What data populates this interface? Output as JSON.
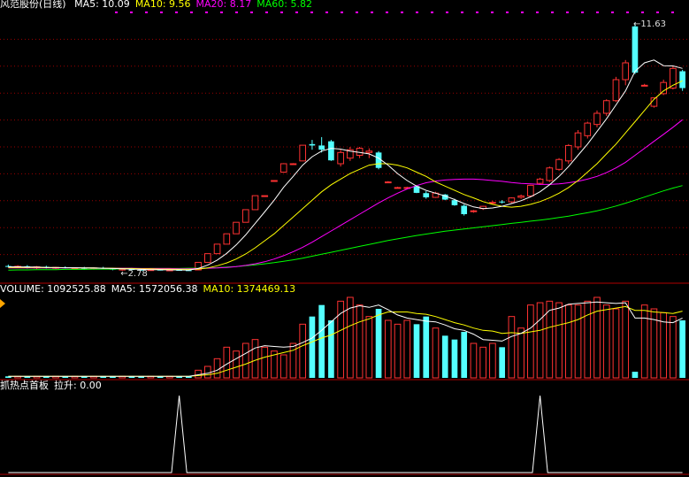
{
  "main_panel": {
    "title": "风范股份(日线)",
    "indicators": [
      {
        "label": "MA5: 10.09",
        "color": "#ffffff"
      },
      {
        "label": "MA10: 9.56",
        "color": "#ffff00"
      },
      {
        "label": "MA20: 8.17",
        "color": "#ff00ff"
      },
      {
        "label": "MA60: 5.82",
        "color": "#00ff00"
      }
    ],
    "high_label": "11.63",
    "low_label": "2.78"
  },
  "volume_panel": {
    "indicators": [
      {
        "label": "VOLUME: 1092525.88",
        "color": "#ffffff"
      },
      {
        "label": "MA5: 1572056.38",
        "color": "#ffffff"
      },
      {
        "label": "MA10: 1374469.13",
        "color": "#ffff00"
      }
    ]
  },
  "indicator_panel": {
    "indicators": [
      {
        "label": "抓热点首板",
        "color": "#ffffff"
      },
      {
        "label": "拉升: 0.00",
        "color": "#ffffff"
      }
    ]
  },
  "colors": {
    "up": "#ff3232",
    "down": "#54ffff",
    "ma5": "#ffffff",
    "ma10": "#ffff00",
    "ma20": "#ff00ff",
    "ma60": "#00ff00",
    "grid": "#9a0000",
    "dots": "#ff00ff"
  },
  "chart_data": {
    "type": "candlestick",
    "ylim": [
      2.4,
      12.0
    ],
    "candles": [
      {
        "o": 2.95,
        "h": 3.0,
        "l": 2.9,
        "c": 2.92
      },
      {
        "o": 2.92,
        "h": 2.98,
        "l": 2.88,
        "c": 2.94
      },
      {
        "o": 2.94,
        "h": 2.98,
        "l": 2.86,
        "c": 2.88
      },
      {
        "o": 2.88,
        "h": 2.95,
        "l": 2.84,
        "c": 2.92
      },
      {
        "o": 2.92,
        "h": 2.96,
        "l": 2.86,
        "c": 2.88
      },
      {
        "o": 2.88,
        "h": 2.92,
        "l": 2.84,
        "c": 2.9
      },
      {
        "o": 2.9,
        "h": 2.94,
        "l": 2.86,
        "c": 2.87
      },
      {
        "o": 2.87,
        "h": 2.9,
        "l": 2.83,
        "c": 2.88
      },
      {
        "o": 2.88,
        "h": 2.92,
        "l": 2.82,
        "c": 2.85
      },
      {
        "o": 2.85,
        "h": 2.9,
        "l": 2.82,
        "c": 2.88
      },
      {
        "o": 2.88,
        "h": 2.92,
        "l": 2.84,
        "c": 2.86
      },
      {
        "o": 2.86,
        "h": 2.88,
        "l": 2.8,
        "c": 2.82
      },
      {
        "o": 2.82,
        "h": 2.86,
        "l": 2.78,
        "c": 2.84
      },
      {
        "o": 2.84,
        "h": 2.88,
        "l": 2.8,
        "c": 2.82
      },
      {
        "o": 2.82,
        "h": 2.86,
        "l": 2.78,
        "c": 2.8
      },
      {
        "o": 2.8,
        "h": 2.84,
        "l": 2.78,
        "c": 2.82
      },
      {
        "o": 2.82,
        "h": 2.85,
        "l": 2.79,
        "c": 2.8
      },
      {
        "o": 2.8,
        "h": 2.83,
        "l": 2.78,
        "c": 2.81
      },
      {
        "o": 2.81,
        "h": 2.84,
        "l": 2.78,
        "c": 2.8
      },
      {
        "o": 2.8,
        "h": 2.82,
        "l": 2.78,
        "c": 2.79
      },
      {
        "o": 2.81,
        "h": 3.08,
        "l": 2.8,
        "c": 3.08
      },
      {
        "o": 3.08,
        "h": 3.39,
        "l": 3.08,
        "c": 3.39
      },
      {
        "o": 3.39,
        "h": 3.73,
        "l": 3.39,
        "c": 3.73
      },
      {
        "o": 3.73,
        "h": 4.1,
        "l": 3.73,
        "c": 4.1
      },
      {
        "o": 4.1,
        "h": 4.51,
        "l": 4.1,
        "c": 4.51
      },
      {
        "o": 4.51,
        "h": 4.96,
        "l": 4.51,
        "c": 4.96
      },
      {
        "o": 4.96,
        "h": 5.46,
        "l": 4.96,
        "c": 5.46
      },
      {
        "o": 5.46,
        "h": 5.46,
        "l": 5.46,
        "c": 5.46
      },
      {
        "o": 6.0,
        "h": 6.0,
        "l": 6.0,
        "c": 6.0
      },
      {
        "o": 6.3,
        "h": 6.62,
        "l": 6.28,
        "c": 6.6
      },
      {
        "o": 6.6,
        "h": 6.62,
        "l": 6.58,
        "c": 6.6
      },
      {
        "o": 6.7,
        "h": 7.26,
        "l": 6.7,
        "c": 7.26
      },
      {
        "o": 7.3,
        "h": 7.45,
        "l": 7.1,
        "c": 7.25
      },
      {
        "o": 7.25,
        "h": 7.55,
        "l": 7.0,
        "c": 7.1
      },
      {
        "o": 7.4,
        "h": 7.45,
        "l": 6.7,
        "c": 6.72
      },
      {
        "o": 6.6,
        "h": 7.1,
        "l": 6.5,
        "c": 7.0
      },
      {
        "o": 6.8,
        "h": 7.2,
        "l": 6.7,
        "c": 7.1
      },
      {
        "o": 6.9,
        "h": 7.2,
        "l": 6.8,
        "c": 7.15
      },
      {
        "o": 7.0,
        "h": 7.15,
        "l": 6.8,
        "c": 7.05
      },
      {
        "o": 7.0,
        "h": 7.05,
        "l": 6.4,
        "c": 6.45
      },
      {
        "o": 5.95,
        "h": 5.98,
        "l": 5.92,
        "c": 5.95
      },
      {
        "o": 5.75,
        "h": 5.78,
        "l": 5.72,
        "c": 5.75
      },
      {
        "o": 5.75,
        "h": 5.78,
        "l": 5.72,
        "c": 5.75
      },
      {
        "o": 5.8,
        "h": 5.82,
        "l": 5.55,
        "c": 5.56
      },
      {
        "o": 5.55,
        "h": 5.62,
        "l": 5.35,
        "c": 5.4
      },
      {
        "o": 5.4,
        "h": 5.6,
        "l": 5.38,
        "c": 5.55
      },
      {
        "o": 5.5,
        "h": 5.52,
        "l": 5.3,
        "c": 5.32
      },
      {
        "o": 5.3,
        "h": 5.35,
        "l": 5.1,
        "c": 5.12
      },
      {
        "o": 5.1,
        "h": 5.15,
        "l": 4.75,
        "c": 4.8
      },
      {
        "o": 4.9,
        "h": 4.95,
        "l": 4.85,
        "c": 4.92
      },
      {
        "o": 5.0,
        "h": 5.1,
        "l": 4.95,
        "c": 5.08
      },
      {
        "o": 5.2,
        "h": 5.28,
        "l": 5.15,
        "c": 5.22
      },
      {
        "o": 5.25,
        "h": 5.3,
        "l": 5.18,
        "c": 5.24
      },
      {
        "o": 5.24,
        "h": 5.4,
        "l": 5.2,
        "c": 5.38
      },
      {
        "o": 5.4,
        "h": 5.5,
        "l": 5.35,
        "c": 5.45
      },
      {
        "o": 5.45,
        "h": 5.85,
        "l": 5.4,
        "c": 5.83
      },
      {
        "o": 5.9,
        "h": 6.1,
        "l": 5.85,
        "c": 6.05
      },
      {
        "o": 6.0,
        "h": 6.5,
        "l": 5.95,
        "c": 6.45
      },
      {
        "o": 6.4,
        "h": 6.8,
        "l": 6.35,
        "c": 6.75
      },
      {
        "o": 6.7,
        "h": 7.3,
        "l": 6.6,
        "c": 7.25
      },
      {
        "o": 7.2,
        "h": 7.8,
        "l": 7.1,
        "c": 7.7
      },
      {
        "o": 7.6,
        "h": 8.1,
        "l": 7.5,
        "c": 8.05
      },
      {
        "o": 8.0,
        "h": 8.5,
        "l": 7.9,
        "c": 8.4
      },
      {
        "o": 8.4,
        "h": 8.9,
        "l": 8.3,
        "c": 8.85
      },
      {
        "o": 8.85,
        "h": 9.7,
        "l": 8.8,
        "c": 9.6
      },
      {
        "o": 9.6,
        "h": 10.3,
        "l": 9.4,
        "c": 10.2
      },
      {
        "o": 11.5,
        "h": 11.63,
        "l": 9.8,
        "c": 9.85
      },
      {
        "o": 9.4,
        "h": 9.45,
        "l": 9.38,
        "c": 9.4
      },
      {
        "o": 8.65,
        "h": 8.95,
        "l": 8.6,
        "c": 8.95
      },
      {
        "o": 9.1,
        "h": 9.6,
        "l": 9.05,
        "c": 9.5
      },
      {
        "o": 9.3,
        "h": 10.1,
        "l": 9.25,
        "c": 10.0
      },
      {
        "o": 9.9,
        "h": 9.95,
        "l": 9.2,
        "c": 9.3
      }
    ],
    "ma5": [
      2.92,
      2.92,
      2.91,
      2.91,
      2.9,
      2.9,
      2.89,
      2.89,
      2.88,
      2.88,
      2.87,
      2.86,
      2.85,
      2.84,
      2.83,
      2.82,
      2.82,
      2.81,
      2.81,
      2.8,
      2.86,
      2.98,
      3.16,
      3.4,
      3.7,
      4.06,
      4.47,
      4.88,
      5.3,
      5.76,
      6.15,
      6.55,
      6.85,
      7.05,
      7.15,
      7.12,
      7.05,
      7.0,
      6.95,
      6.8,
      6.55,
      6.25,
      6.0,
      5.8,
      5.65,
      5.55,
      5.45,
      5.32,
      5.18,
      5.06,
      5.0,
      5.02,
      5.08,
      5.18,
      5.28,
      5.42,
      5.6,
      5.85,
      6.15,
      6.5,
      6.9,
      7.3,
      7.75,
      8.2,
      8.7,
      9.2,
      9.9,
      10.2,
      10.3,
      10.1,
      10.09,
      10.0
    ],
    "ma10": [
      2.9,
      2.9,
      2.9,
      2.9,
      2.89,
      2.89,
      2.89,
      2.88,
      2.88,
      2.88,
      2.87,
      2.87,
      2.86,
      2.86,
      2.85,
      2.85,
      2.84,
      2.84,
      2.83,
      2.83,
      2.84,
      2.88,
      2.96,
      3.06,
      3.2,
      3.38,
      3.6,
      3.85,
      4.1,
      4.4,
      4.7,
      5.0,
      5.3,
      5.6,
      5.85,
      6.05,
      6.25,
      6.4,
      6.55,
      6.6,
      6.6,
      6.55,
      6.45,
      6.3,
      6.15,
      5.95,
      5.8,
      5.65,
      5.5,
      5.38,
      5.25,
      5.15,
      5.08,
      5.05,
      5.08,
      5.15,
      5.25,
      5.38,
      5.55,
      5.75,
      6.0,
      6.3,
      6.6,
      6.95,
      7.3,
      7.7,
      8.1,
      8.5,
      8.9,
      9.2,
      9.4,
      9.56
    ],
    "ma20": [
      2.88,
      2.88,
      2.88,
      2.88,
      2.88,
      2.88,
      2.88,
      2.88,
      2.88,
      2.87,
      2.87,
      2.87,
      2.87,
      2.87,
      2.86,
      2.86,
      2.86,
      2.86,
      2.85,
      2.85,
      2.86,
      2.87,
      2.88,
      2.9,
      2.93,
      2.97,
      3.03,
      3.1,
      3.2,
      3.32,
      3.46,
      3.62,
      3.8,
      4.0,
      4.2,
      4.4,
      4.6,
      4.8,
      5.0,
      5.2,
      5.38,
      5.55,
      5.7,
      5.82,
      5.92,
      5.98,
      6.02,
      6.04,
      6.05,
      6.05,
      6.03,
      6.0,
      5.97,
      5.93,
      5.9,
      5.88,
      5.86,
      5.86,
      5.88,
      5.92,
      5.97,
      6.05,
      6.15,
      6.28,
      6.45,
      6.65,
      6.9,
      7.15,
      7.4,
      7.65,
      7.9,
      8.17
    ],
    "ma60": [
      2.8,
      2.81,
      2.81,
      2.82,
      2.82,
      2.82,
      2.83,
      2.83,
      2.83,
      2.84,
      2.84,
      2.84,
      2.85,
      2.85,
      2.85,
      2.86,
      2.86,
      2.86,
      2.86,
      2.87,
      2.87,
      2.88,
      2.89,
      2.91,
      2.93,
      2.96,
      2.99,
      3.03,
      3.07,
      3.12,
      3.17,
      3.23,
      3.3,
      3.37,
      3.44,
      3.51,
      3.58,
      3.65,
      3.72,
      3.79,
      3.86,
      3.92,
      3.98,
      4.04,
      4.09,
      4.14,
      4.19,
      4.23,
      4.27,
      4.31,
      4.35,
      4.39,
      4.43,
      4.47,
      4.51,
      4.55,
      4.59,
      4.63,
      4.68,
      4.73,
      4.79,
      4.85,
      4.92,
      5.0,
      5.09,
      5.19,
      5.3,
      5.41,
      5.52,
      5.63,
      5.73,
      5.82
    ],
    "volume": [
      0.02,
      0.02,
      0.02,
      0.02,
      0.02,
      0.02,
      0.02,
      0.02,
      0.02,
      0.02,
      0.02,
      0.02,
      0.02,
      0.02,
      0.02,
      0.02,
      0.02,
      0.02,
      0.02,
      0.02,
      0.1,
      0.15,
      0.25,
      0.4,
      0.35,
      0.45,
      0.5,
      0.4,
      0.35,
      0.3,
      0.45,
      0.7,
      0.8,
      0.95,
      0.75,
      1.0,
      1.05,
      0.95,
      0.8,
      0.9,
      0.75,
      0.7,
      0.75,
      0.7,
      0.8,
      0.65,
      0.55,
      0.5,
      0.6,
      0.45,
      0.4,
      0.45,
      0.4,
      0.8,
      0.65,
      0.95,
      0.98,
      1.0,
      0.98,
      0.95,
      0.95,
      1.0,
      1.05,
      0.95,
      0.9,
      1.0,
      0.08,
      0.95,
      0.9,
      0.85,
      0.8,
      0.75
    ],
    "vol_ma5": [
      0.02,
      0.02,
      0.02,
      0.02,
      0.02,
      0.02,
      0.02,
      0.02,
      0.02,
      0.02,
      0.02,
      0.02,
      0.02,
      0.02,
      0.02,
      0.02,
      0.02,
      0.02,
      0.02,
      0.02,
      0.04,
      0.06,
      0.1,
      0.18,
      0.25,
      0.32,
      0.39,
      0.42,
      0.41,
      0.4,
      0.41,
      0.46,
      0.52,
      0.62,
      0.73,
      0.84,
      0.91,
      0.94,
      0.92,
      0.95,
      0.89,
      0.82,
      0.78,
      0.76,
      0.74,
      0.73,
      0.69,
      0.64,
      0.62,
      0.57,
      0.5,
      0.49,
      0.48,
      0.54,
      0.58,
      0.65,
      0.76,
      0.88,
      0.91,
      0.96,
      0.97,
      0.98,
      0.99,
      0.98,
      0.97,
      0.98,
      0.78,
      0.78,
      0.76,
      0.73,
      0.72,
      0.78
    ],
    "vol_ma10": [
      0.02,
      0.02,
      0.02,
      0.02,
      0.02,
      0.02,
      0.02,
      0.02,
      0.02,
      0.02,
      0.02,
      0.02,
      0.02,
      0.02,
      0.02,
      0.02,
      0.02,
      0.02,
      0.02,
      0.02,
      0.03,
      0.04,
      0.06,
      0.1,
      0.14,
      0.18,
      0.23,
      0.27,
      0.3,
      0.33,
      0.36,
      0.42,
      0.47,
      0.52,
      0.56,
      0.62,
      0.68,
      0.73,
      0.77,
      0.82,
      0.86,
      0.86,
      0.86,
      0.84,
      0.83,
      0.8,
      0.76,
      0.72,
      0.69,
      0.65,
      0.62,
      0.61,
      0.58,
      0.59,
      0.58,
      0.6,
      0.62,
      0.66,
      0.69,
      0.72,
      0.76,
      0.82,
      0.87,
      0.89,
      0.91,
      0.93,
      0.88,
      0.88,
      0.86,
      0.85,
      0.84,
      0.87
    ],
    "signal": [
      0,
      0,
      0,
      0,
      0,
      0,
      0,
      0,
      0,
      0,
      0,
      0,
      0,
      0,
      0,
      0,
      0,
      0,
      1,
      0,
      0,
      0,
      0,
      0,
      0,
      0,
      0,
      0,
      0,
      0,
      0,
      0,
      0,
      0,
      0,
      0,
      0,
      0,
      0,
      0,
      0,
      0,
      0,
      0,
      0,
      0,
      0,
      0,
      0,
      0,
      0,
      0,
      0,
      0,
      0,
      0,
      1,
      0,
      0,
      0,
      0,
      0,
      0,
      0,
      0,
      0,
      0,
      0,
      0,
      0,
      0,
      0
    ]
  }
}
